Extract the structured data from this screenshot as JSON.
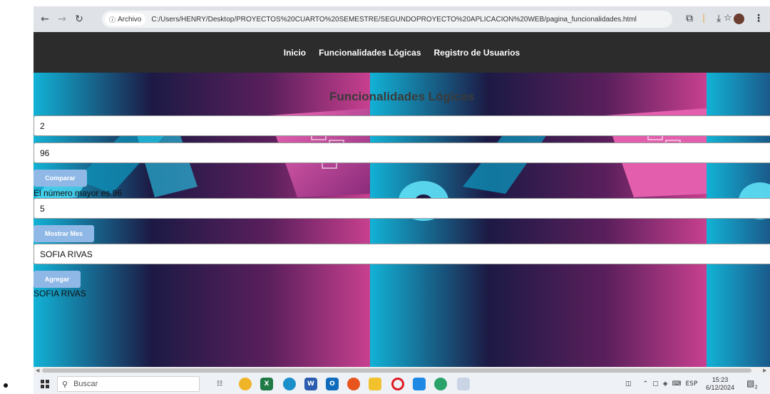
{
  "browser": {
    "security_chip": "Archivo",
    "url": "C:/Users/HENRY/Desktop/PROYECTOS%20CUARTO%20SEMESTRE/SEGUNDOPROYECTO%20APLICACION%20WEB/pagina_funcionalidades.html",
    "icons": [
      "back-icon",
      "forward-icon",
      "reload-icon",
      "info-icon",
      "star-icon",
      "extensions-icon",
      "download-icon",
      "profile-avatar",
      "menu-icon"
    ]
  },
  "nav": {
    "items": [
      "Inicio",
      "Funcionalidades Lógicas",
      "Registro de Usuarios"
    ]
  },
  "page": {
    "title": "Funcionalidades Lógicas",
    "compare": {
      "input1": "2",
      "input2": "96",
      "button": "Comparar",
      "result": "El número mayor es 96"
    },
    "month": {
      "input": "5",
      "button": "Mostrar Mes"
    },
    "add": {
      "input": "SOFIA RIVAS",
      "button": "Agregar",
      "result": "SOFIA RIVAS"
    }
  },
  "taskbar": {
    "search_placeholder": "Buscar",
    "language": "ESP",
    "time": "15:23",
    "date": "6/12/2024",
    "notification_count": "2"
  },
  "colors": {
    "navbar": "#2c2c2c",
    "button": "#8fb8e6",
    "hero_cyan": "#10b4d8",
    "hero_pink": "#d0409a",
    "hero_dark": "#1c1840"
  }
}
